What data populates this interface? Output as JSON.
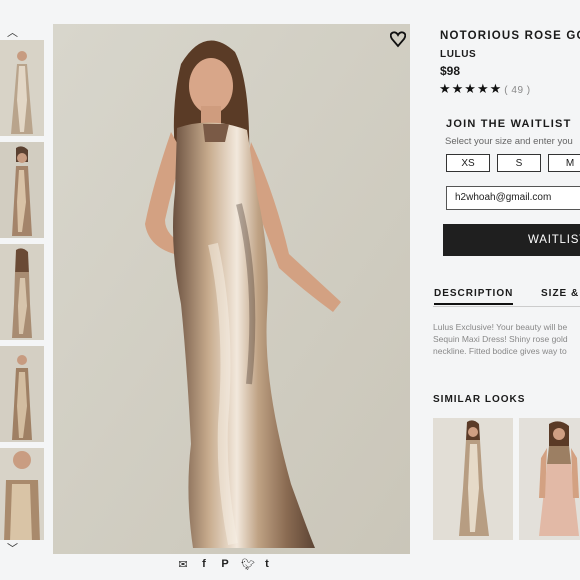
{
  "product": {
    "title": "NOTORIOUS ROSE GO",
    "brand": "LULUS",
    "price": "$98",
    "stars": "★★★★★",
    "rating_count": "( 49 )"
  },
  "waitlist": {
    "heading": "JOIN THE WAITLIST",
    "subtitle": "Select your size and enter you",
    "sizes": [
      "XS",
      "S",
      "M"
    ],
    "email_value": "h2whoah@gmail.com",
    "button_label": "WAITLIST"
  },
  "tabs": {
    "description": "DESCRIPTION",
    "size": "SIZE &"
  },
  "description": {
    "line1": "Lulus Exclusive! Your beauty will be",
    "line2": "Sequin Maxi Dress! Shiny rose gold",
    "line3": "neckline. Fitted bodice gives way to"
  },
  "similar": {
    "heading": "SIMILAR LOOKS"
  },
  "icons": {
    "rail_up": "chevron-up-icon",
    "rail_down": "chevron-down-icon",
    "favorite": "heart-icon",
    "share": [
      "mail-icon",
      "facebook-icon",
      "pinterest-icon",
      "twitter-icon",
      "tumblr-icon"
    ]
  },
  "colors": {
    "button_bg": "#1f1f1f",
    "dress_gold": "#b89a7a"
  }
}
